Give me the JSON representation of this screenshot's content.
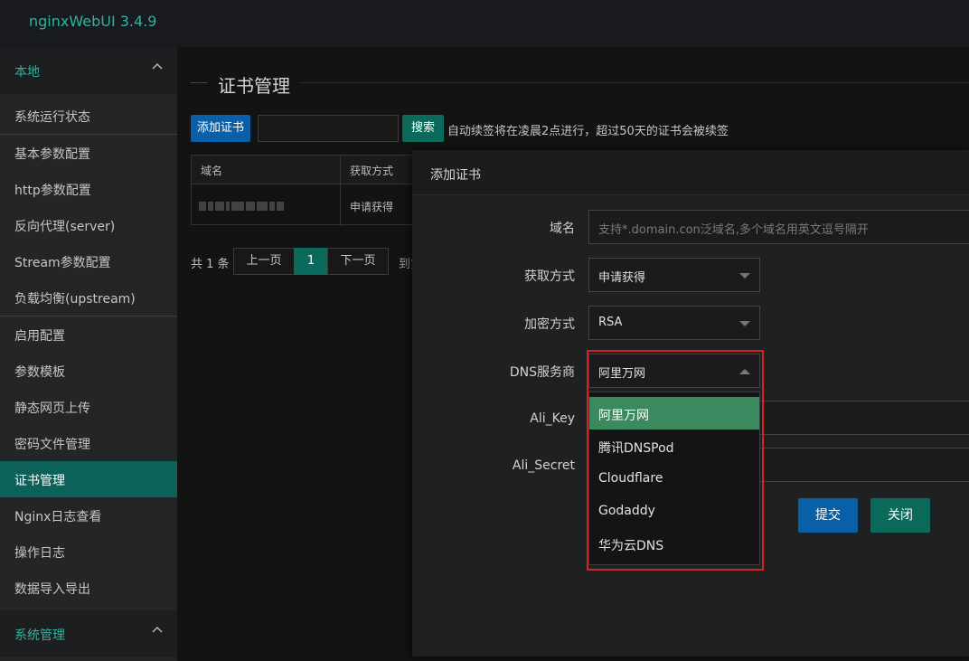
{
  "app": {
    "title": "nginxWebUI 3.4.9"
  },
  "sidebar": {
    "group_local": "本地",
    "group_system": "系统管理",
    "items": [
      "系统运行状态",
      "基本参数配置",
      "http参数配置",
      "反向代理(server)",
      "Stream参数配置",
      "负载均衡(upstream)",
      "启用配置",
      "参数模板",
      "静态网页上传",
      "密码文件管理",
      "证书管理",
      "Nginx日志查看",
      "操作日志",
      "数据导入导出"
    ],
    "active_item": "证书管理"
  },
  "page": {
    "title": "证书管理",
    "add_button": "添加证书",
    "search_button": "搜索",
    "search_value": "",
    "hint": "自动续签将在凌晨2点进行，超过50天的证书会被续签"
  },
  "table": {
    "headers": [
      "域名",
      "获取方式"
    ],
    "rows": [
      {
        "domain": "",
        "method": "申请获得"
      }
    ]
  },
  "pager": {
    "total": "共 1 条",
    "prev": "上一页",
    "current": "1",
    "next": "下一页",
    "goto": "到第"
  },
  "modal": {
    "title": "添加证书",
    "fields": {
      "domain_label": "域名",
      "domain_placeholder": "支持*.domain.con泛域名,多个域名用英文逗号隔开",
      "method_label": "获取方式",
      "method_value": "申请获得",
      "encrypt_label": "加密方式",
      "encrypt_value": "RSA",
      "dns_label": "DNS服务商",
      "dns_value": "阿里万网",
      "ali_key_label": "Ali_Key",
      "ali_secret_label": "Ali_Secret"
    },
    "dns_options": [
      "阿里万网",
      "腾讯DNSPod",
      "Cloudflare",
      "Godaddy",
      "华为云DNS"
    ],
    "submit": "提交",
    "close": "关闭"
  },
  "colors": {
    "accent_teal": "#2fb3a1",
    "primary_blue": "#0a60a8",
    "secondary_green": "#0b6a5b",
    "selected_option": "#3b8a5f",
    "highlight_red": "#d62126"
  },
  "icons": {
    "group_collapse": "chevron-up-icon",
    "select_caret": "caret-down-icon",
    "select_caret_open": "caret-up-icon"
  }
}
